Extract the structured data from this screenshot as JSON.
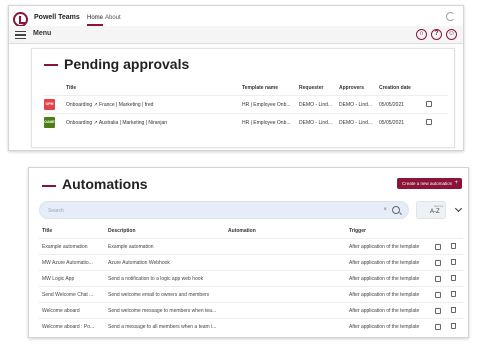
{
  "colors": {
    "accent": "#8b1538",
    "badge_fra": "#e0454a",
    "badge_oae": "#4d7f14",
    "search_bg": "#e6edf8"
  },
  "app": {
    "title": "Powell Teams",
    "tabs": [
      {
        "label": "Home",
        "active": true
      },
      {
        "label": "About",
        "active": false
      }
    ],
    "icons": [
      "logo-icon",
      "refresh-icon"
    ]
  },
  "menubar": {
    "label": "Menu",
    "icons": [
      "headset-icon",
      "help-icon",
      "smiley-icon"
    ],
    "icon_glyphs": [
      "∩",
      "?",
      "☺"
    ]
  },
  "pending": {
    "title": "Pending approvals",
    "columns": [
      "Title",
      "Template name",
      "Requester",
      "Approvers",
      "Creation date"
    ],
    "rows": [
      {
        "badge": "OFM",
        "badge_color": "#e0454a",
        "title": "Onboarding ↗ France | Marketing | fred",
        "template": "HR | Employee Onb...",
        "requester": "DEMO - Lind...",
        "approvers": "DEMO - Lind...",
        "date": "05/05/2021"
      },
      {
        "badge": "OAME",
        "badge_color": "#4d7f14",
        "title": "Onboarding ↗ Australia | Marketing | Niranjan",
        "template": "HR | Employee Onb...",
        "requester": "DEMO - Lind...",
        "approvers": "DEMO - Lind...",
        "date": "05/05/2021"
      }
    ]
  },
  "automations": {
    "title": "Automations",
    "create_label": "Create a new automation",
    "create_icon": "+",
    "search_placeholder": "Search",
    "clear_glyph": "×",
    "sort_label": "Sort by",
    "sort_value": "A-Z",
    "columns": [
      "Title",
      "Description",
      "Automation",
      "Trigger"
    ],
    "rows": [
      {
        "title": "Example automation",
        "description": "Example automation",
        "automation": "",
        "trigger": "After application of the template"
      },
      {
        "title": "MW Azure Automatio...",
        "description": "Azure Automation Webhook",
        "automation": "",
        "trigger": "After application of the template"
      },
      {
        "title": "MW Logic App",
        "description": "Send a notification to a logic app web hook",
        "automation": "",
        "trigger": "After application of the template"
      },
      {
        "title": "Send Welcome Chat ...",
        "description": "Send welcome email to owners and members",
        "automation": "",
        "trigger": "After application of the template"
      },
      {
        "title": "Welcome aboard",
        "description": "Send welcome message to members when tea...",
        "automation": "",
        "trigger": "After application of the template"
      },
      {
        "title": "Welcome aboard : Po...",
        "description": "Send a message to all members when a team i...",
        "automation": "",
        "trigger": "After application of the template"
      }
    ]
  }
}
